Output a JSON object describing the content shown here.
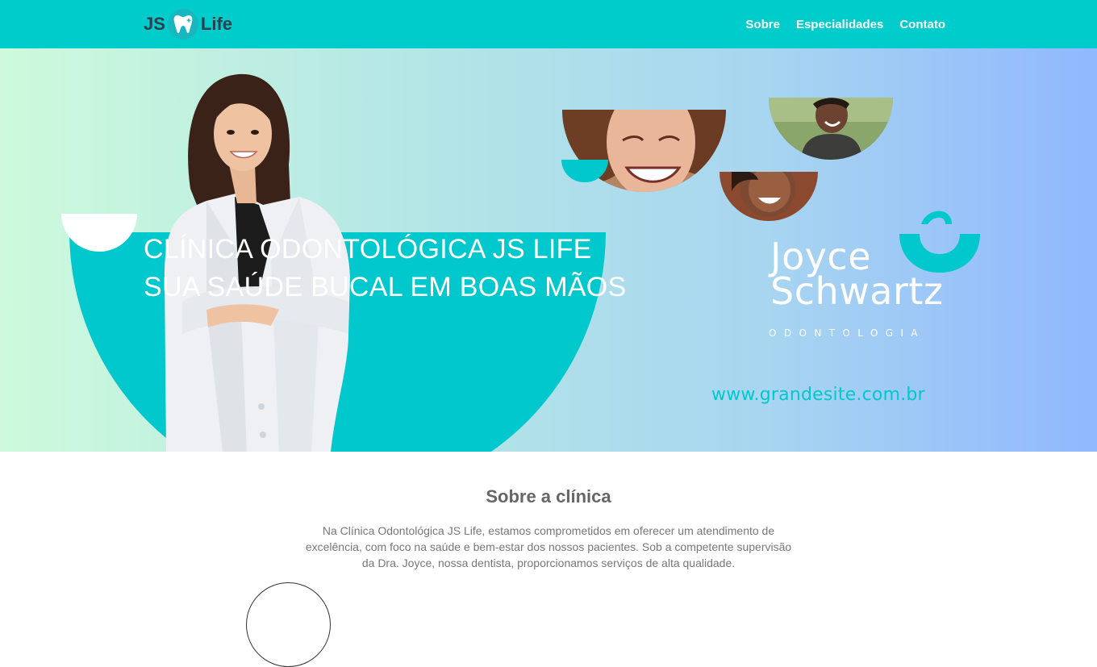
{
  "navbar": {
    "logo": {
      "left_text": "JS",
      "right_text": "Life",
      "icon": "tooth-icon"
    },
    "links": [
      {
        "label": "Sobre"
      },
      {
        "label": "Especialidades"
      },
      {
        "label": "Contato"
      }
    ],
    "color": "#00cccc"
  },
  "hero": {
    "title": "CLÍNICA ODONTOLÓGICA JS LIFE SUA SAÚDE BUCAL EM BOAS MÃOS",
    "brand": {
      "line1": "Joyce",
      "line2": "Schwartz",
      "subtitle": "ODONTOLOGIA",
      "url": "www.grandesite.com.br"
    },
    "accent_color": "#00c8cc"
  },
  "about": {
    "title": "Sobre a clínica",
    "text": "Na Clínica Odontológica JS Life, estamos comprometidos em oferecer um atendimento de excelência, com foco na saúde e bem-estar dos nossos pacientes. Sob a competente supervisão da Dra. Joyce, nossa dentista, proporcionamos serviços de alta qualidade."
  }
}
